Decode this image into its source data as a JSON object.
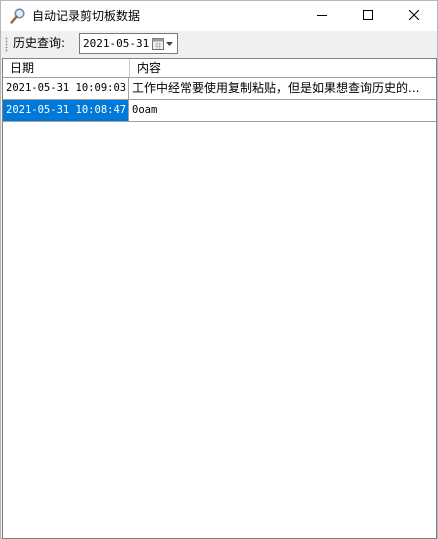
{
  "window": {
    "title": "自动记录剪切板数据",
    "icon": "search-icon",
    "controls": {
      "minimize": "minimize-icon",
      "maximize": "maximize-icon",
      "close": "close-icon"
    }
  },
  "toolbar": {
    "query_label": "历史查询:",
    "date_value": "2021-05-31",
    "calendar_icon": "calendar-icon"
  },
  "grid": {
    "columns": [
      "日期",
      "内容"
    ],
    "rows": [
      {
        "date": "2021-05-31 10:09:03",
        "content": "工作中经常要使用复制粘贴，但是如果想查询历史的..."
      },
      {
        "date": "2021-05-31 10:08:47",
        "content": "0oam",
        "selected": true
      }
    ]
  },
  "colors": {
    "selection": "#0078d7",
    "grid_line": "#a0a0a0",
    "window_bg": "#f0f0f0"
  }
}
